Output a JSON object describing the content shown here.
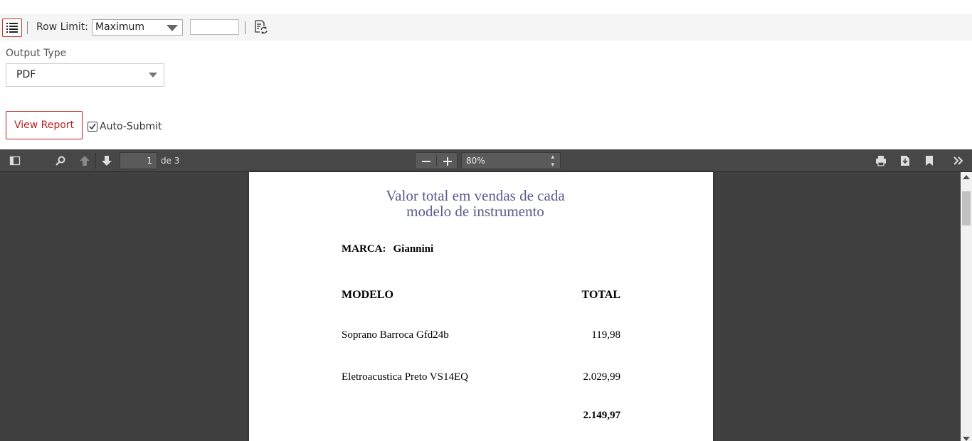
{
  "toolbar": {
    "row_limit_label": "Row Limit:",
    "row_limit_value": "Maximum",
    "row_limit_input": ""
  },
  "output": {
    "label": "Output Type",
    "value": "PDF"
  },
  "actions": {
    "view_report": "View Report",
    "auto_submit_label": "Auto-Submit",
    "auto_submit_checked": true
  },
  "pdf_viewer": {
    "current_page": "1",
    "page_of": "de 3",
    "zoom": "80%"
  },
  "report": {
    "title_line1": "Valor total em vendas de cada",
    "title_line2": "modelo de instrumento",
    "marca_label": "MARCA:",
    "marca_value": "Giannini",
    "col_model": "MODELO",
    "col_total": "TOTAL",
    "rows": [
      {
        "model": "Soprano Barroca Gfd24b",
        "total": "119,98"
      },
      {
        "model": "Eletroacustica Preto VS14EQ",
        "total": "2.029,99"
      }
    ],
    "sum": "2.149,97"
  },
  "colors": {
    "accent": "#bb2222",
    "title": "#5b5b8c",
    "viewer_bg": "#404040"
  }
}
